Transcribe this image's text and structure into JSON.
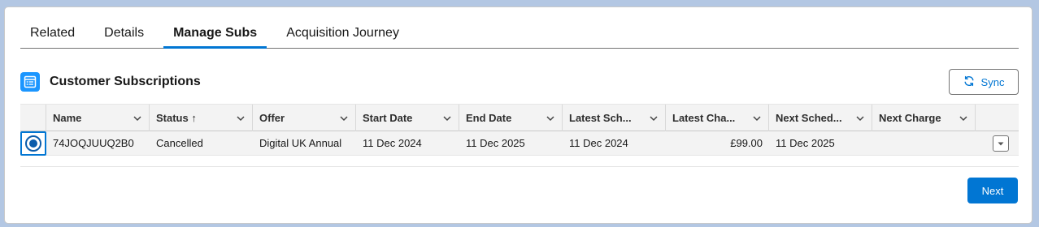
{
  "tabs": [
    {
      "label": "Related"
    },
    {
      "label": "Details"
    },
    {
      "label": "Manage Subs"
    },
    {
      "label": "Acquisition Journey"
    }
  ],
  "section": {
    "title": "Customer Subscriptions",
    "sync_label": "Sync"
  },
  "table": {
    "columns": [
      {
        "label": "Name"
      },
      {
        "label": "Status",
        "sort_indicator": "↑"
      },
      {
        "label": "Offer"
      },
      {
        "label": "Start Date"
      },
      {
        "label": "End Date"
      },
      {
        "label": "Latest Sch..."
      },
      {
        "label": "Latest Cha..."
      },
      {
        "label": "Next Sched..."
      },
      {
        "label": "Next Charge"
      }
    ],
    "rows": [
      {
        "name": "74JOQJUUQ2B0",
        "status": "Cancelled",
        "offer": "Digital UK Annual",
        "start_date": "11 Dec 2024",
        "end_date": "11 Dec 2025",
        "latest_scheduled": "11 Dec 2024",
        "latest_charge": "£99.00",
        "next_scheduled": "11 Dec 2025",
        "next_charge": ""
      }
    ]
  },
  "footer": {
    "next_label": "Next"
  },
  "colors": {
    "brand": "#0176d3",
    "icon_bg": "#1b96ff",
    "page_bg": "#b3c7e3"
  },
  "icons": {
    "section": "table-list-icon",
    "sync": "refresh-icon",
    "column_menu": "chevron-down-icon",
    "row_menu": "chevron-down-icon"
  }
}
